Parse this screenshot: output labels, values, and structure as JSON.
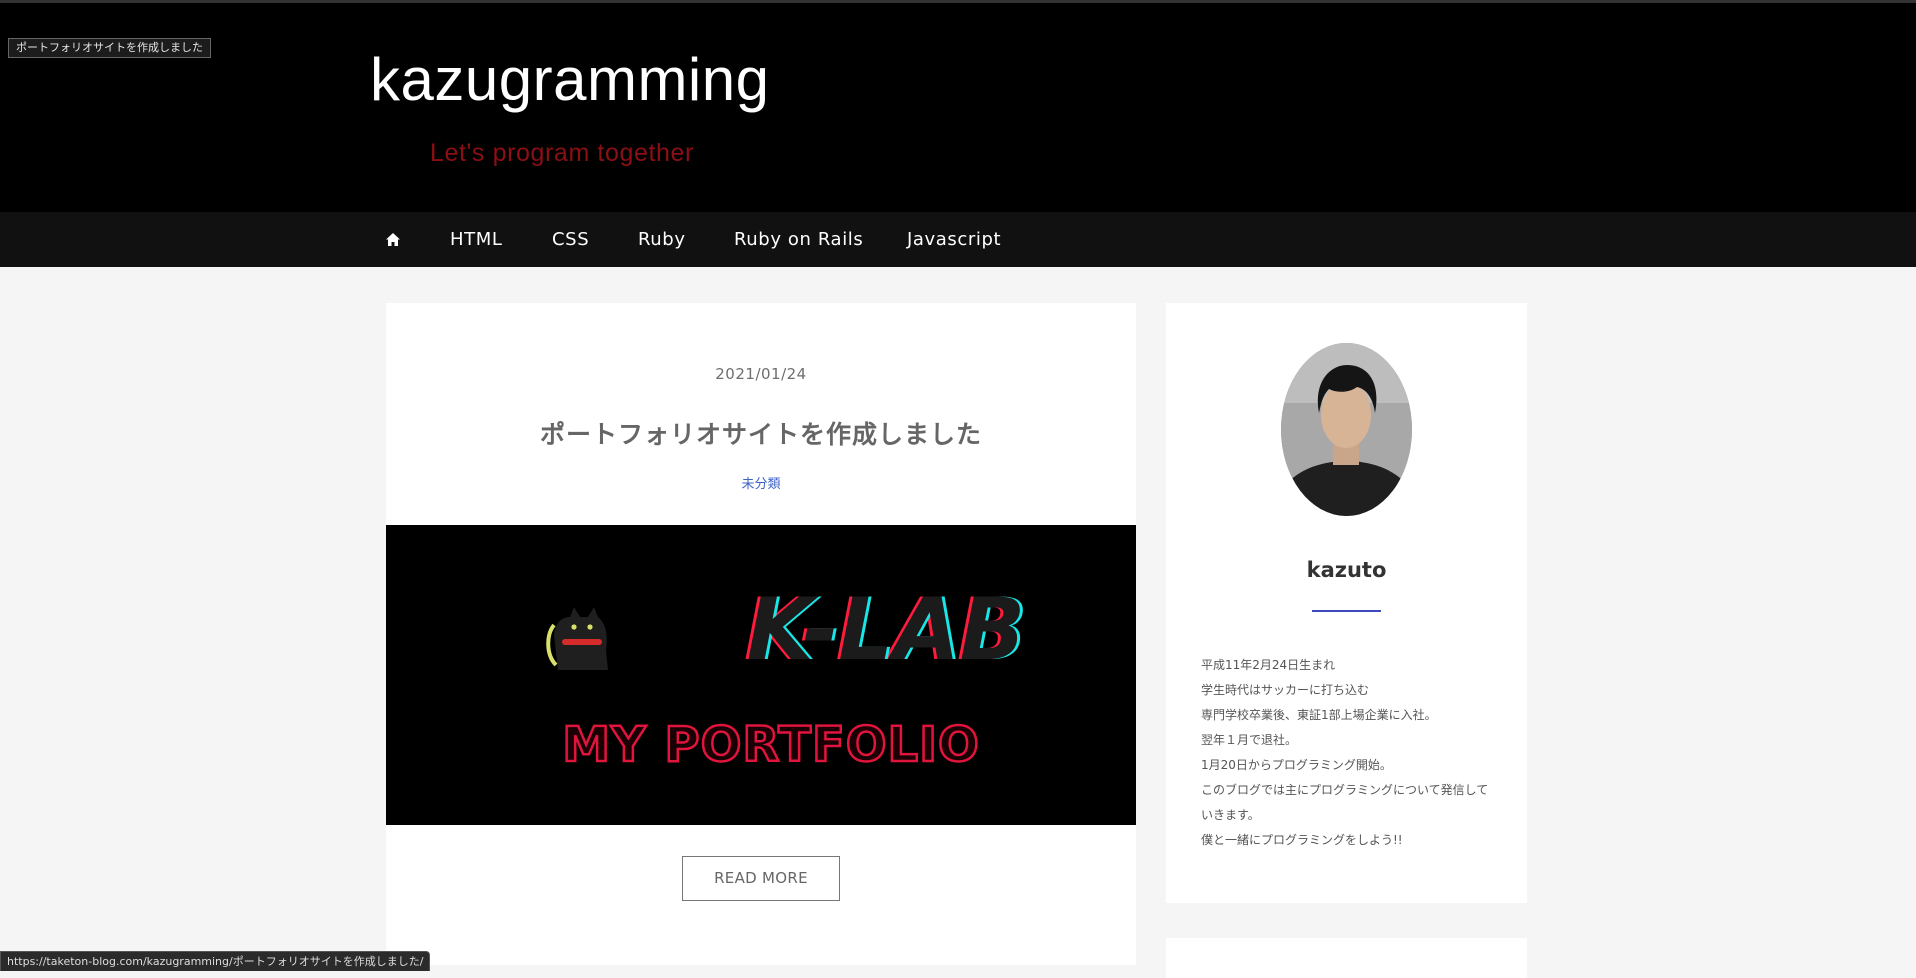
{
  "tooltip": "ポートフォリオサイトを作成しました",
  "header": {
    "title": "kazugramming",
    "tagline": "Let's program together"
  },
  "nav": {
    "home_icon": "home-icon",
    "items": [
      {
        "label": "HTML"
      },
      {
        "label": "CSS"
      },
      {
        "label": "Ruby"
      },
      {
        "label": "Ruby on Rails"
      },
      {
        "label": "Javascript"
      }
    ]
  },
  "post": {
    "date": "2021/01/24",
    "title": "ポートフォリオサイトを作成しました",
    "category": "未分類",
    "thumbnail": {
      "logo": "K-LAB",
      "subtitle": "MY PORTFOLIO",
      "icon": "cat-icon"
    },
    "read_more": "READ MORE"
  },
  "sidebar": {
    "profile": {
      "name": "kazuto",
      "bio": [
        "平成11年2月24日生まれ",
        "学生時代はサッカーに打ち込む",
        "専門学校卒業後、東証1部上場企業に入社。",
        "翌年１月で退社。",
        "1月20日からプログラミング開始。",
        "このブログでは主にプログラミングについて発信して",
        "いきます。",
        "僕と一緒にプログラミングをしよう!!"
      ]
    }
  },
  "status_url": "https://taketon-blog.com/kazugramming/ポートフォリオサイトを作成しました/",
  "colors": {
    "header_bg": "#000000",
    "nav_bg": "#111111",
    "tagline": "#8b0f15",
    "accent": "#3f4bb8",
    "page_bg": "#f5f5f5"
  }
}
